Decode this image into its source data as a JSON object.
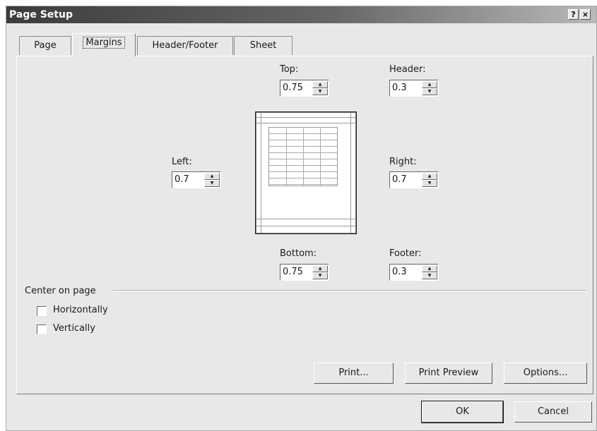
{
  "window": {
    "title": "Page Setup",
    "help_label": "?",
    "close_label": "×"
  },
  "tabs": [
    {
      "label": "Page",
      "active": false
    },
    {
      "label": "Margins",
      "active": true
    },
    {
      "label": "Header/Footer",
      "active": false
    },
    {
      "label": "Sheet",
      "active": false
    }
  ],
  "margins": {
    "top": {
      "label": "Top:",
      "value": "0.75"
    },
    "header": {
      "label": "Header:",
      "value": "0.3"
    },
    "left": {
      "label": "Left:",
      "value": "0.7"
    },
    "right": {
      "label": "Right:",
      "value": "0.7"
    },
    "bottom": {
      "label": "Bottom:",
      "value": "0.75"
    },
    "footer": {
      "label": "Footer:",
      "value": "0.3"
    }
  },
  "center_on_page": {
    "label": "Center on page",
    "horizontally": {
      "label": "Horizontally",
      "checked": false
    },
    "vertically": {
      "label": "Vertically",
      "checked": false
    }
  },
  "buttons": {
    "print": "Print...",
    "print_preview": "Print Preview",
    "options": "Options...",
    "ok": "OK",
    "cancel": "Cancel"
  },
  "icons": [
    "spin-up-icon",
    "spin-down-icon",
    "help-icon",
    "close-icon"
  ]
}
